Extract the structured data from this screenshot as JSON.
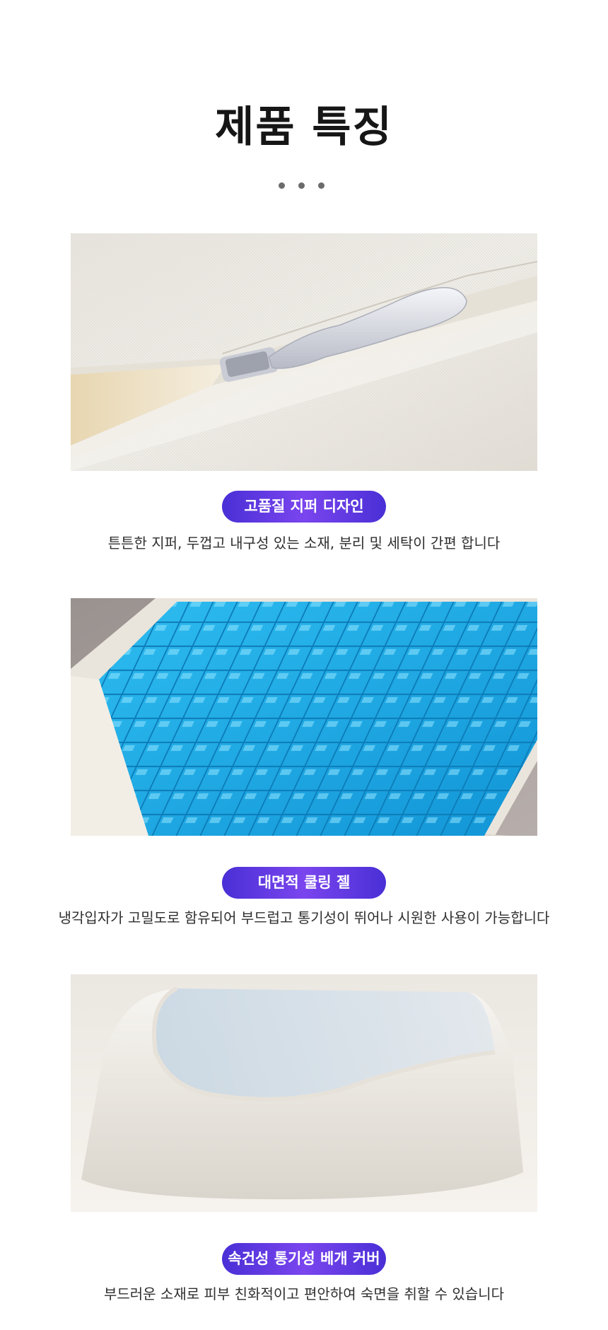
{
  "page": {
    "title": "제품 특징"
  },
  "features": [
    {
      "badge": "고품질 지퍼 디자인",
      "description": "튼튼한 지퍼, 두껍고 내구성 있는 소재, 분리 및 세탁이 간편 합니다"
    },
    {
      "badge": "대면적 쿨링 젤",
      "description": "냉각입자가 고밀도로 함유되어 부드럽고 통기성이 뛰어나 시원한 사용이 가능합니다"
    },
    {
      "badge": "속건성 통기성 베개 커버",
      "description": "부드러운 소재로 피부 친화적이고 편안하여 숙면을 취할 수 있습니다"
    }
  ],
  "colors": {
    "badge_gradient_start": "#4a2fd6",
    "badge_gradient_mid": "#7a45ee",
    "gel": "#1eaee8"
  }
}
